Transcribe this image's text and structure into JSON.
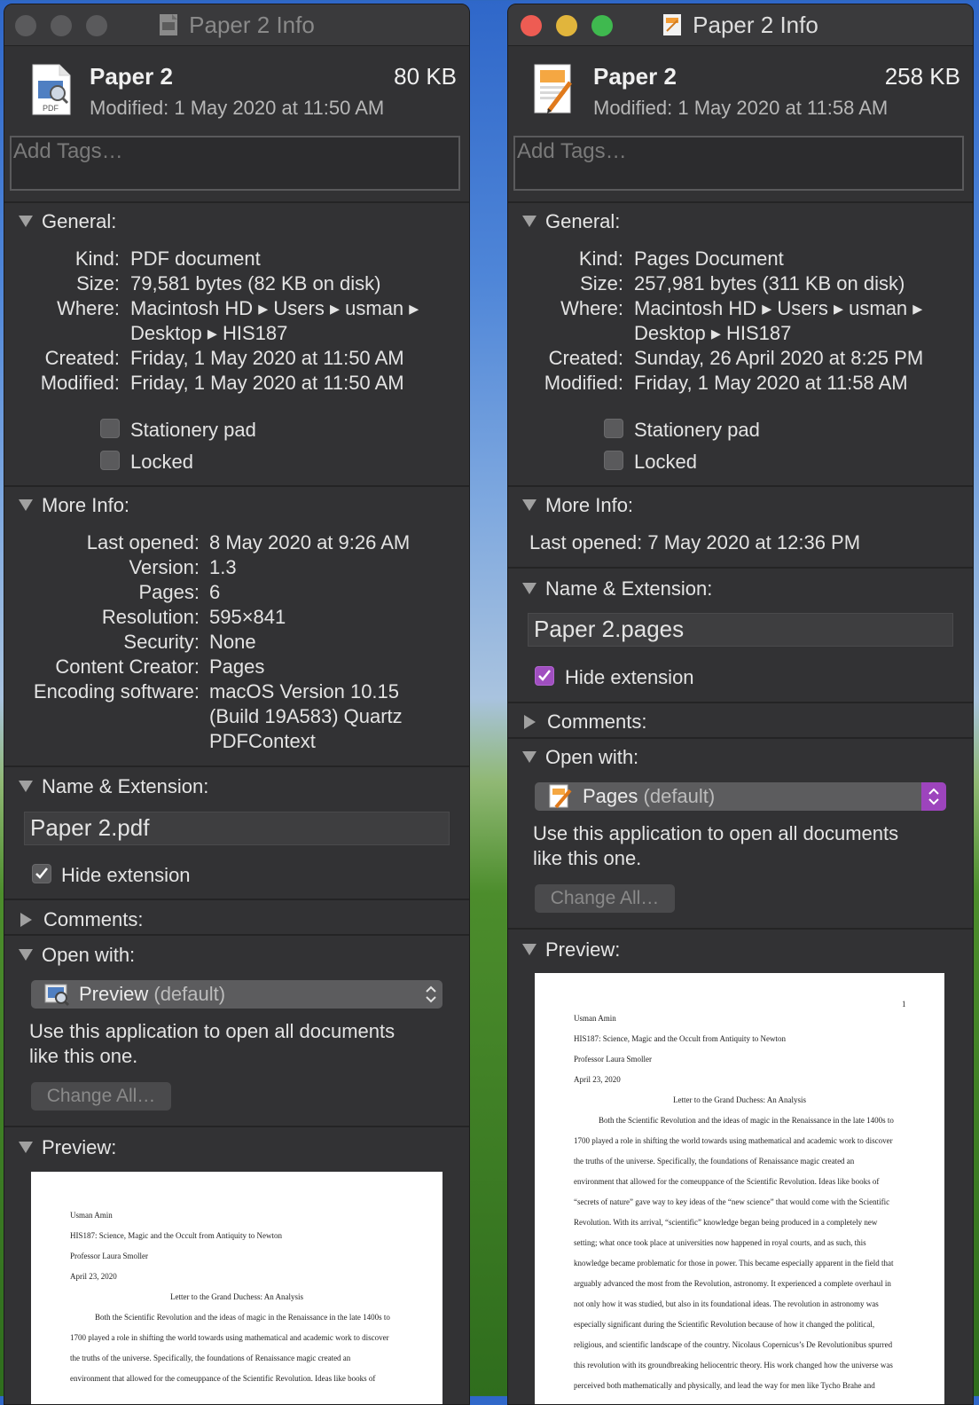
{
  "left": {
    "title": "Paper 2 Info",
    "name": "Paper 2",
    "size": "80 KB",
    "modified": "Modified: 1 May 2020 at 11:50 AM",
    "tags_placeholder": "Add Tags…",
    "file_icon_label": "PDF",
    "general": {
      "header": "General:",
      "kind_label": "Kind:",
      "kind": "PDF document",
      "size_label": "Size:",
      "size": "79,581 bytes (82 KB on disk)",
      "where_label": "Where:",
      "where_line1": "Macintosh HD ▸ Users ▸ usman ▸",
      "where_line2": "Desktop ▸ HIS187",
      "created_label": "Created:",
      "created": "Friday, 1 May 2020 at 11:50 AM",
      "modified_label": "Modified:",
      "modified": "Friday, 1 May 2020 at 11:50 AM",
      "stationery": "Stationery pad",
      "locked": "Locked"
    },
    "more_info": {
      "header": "More Info:",
      "last_opened_label": "Last opened:",
      "last_opened": "8 May 2020 at 9:26 AM",
      "version_label": "Version:",
      "version": "1.3",
      "pages_label": "Pages:",
      "pages": "6",
      "resolution_label": "Resolution:",
      "resolution": "595×841",
      "security_label": "Security:",
      "security": "None",
      "creator_label": "Content Creator:",
      "creator": "Pages",
      "encoding_label": "Encoding software:",
      "encoding_line1": "macOS Version 10.15",
      "encoding_line2": "(Build 19A583) Quartz",
      "encoding_line3": "PDFContext"
    },
    "name_ext": {
      "header": "Name & Extension:",
      "value": "Paper 2.pdf",
      "hide": "Hide extension",
      "hide_checked": true
    },
    "comments_header": "Comments:",
    "open_with": {
      "header": "Open with:",
      "app": "Preview",
      "default": "(default)",
      "desc_line1": "Use this application to open all documents",
      "desc_line2": "like this one.",
      "change_all": "Change All…"
    },
    "preview": {
      "header": "Preview:",
      "lines": [
        "Usman Amin",
        "HIS187: Science, Magic and the Occult from Antiquity to Newton",
        "Professor Laura Smoller",
        "April 23, 2020",
        "Letter to the Grand Duchess: An Analysis",
        "Both the Scientific Revolution and the ideas of magic in the Renaissance in the late 1400s to",
        "1700 played a role in shifting the world towards using mathematical and academic work to discover",
        "the truths of the universe. Specifically, the foundations of Renaissance magic created an",
        "environment that allowed for the comeuppance of the Scientific Revolution. Ideas like books of"
      ]
    }
  },
  "right": {
    "title": "Paper 2 Info",
    "name": "Paper 2",
    "size": "258 KB",
    "modified": "Modified: 1 May 2020 at 11:58 AM",
    "tags_placeholder": "Add Tags…",
    "general": {
      "header": "General:",
      "kind_label": "Kind:",
      "kind": "Pages Document",
      "size_label": "Size:",
      "size": "257,981 bytes (311 KB on disk)",
      "where_label": "Where:",
      "where_line1": "Macintosh HD ▸ Users ▸ usman ▸",
      "where_line2": "Desktop ▸ HIS187",
      "created_label": "Created:",
      "created": "Sunday, 26 April 2020 at 8:25 PM",
      "modified_label": "Modified:",
      "modified": "Friday, 1 May 2020 at 11:58 AM",
      "stationery": "Stationery pad",
      "locked": "Locked"
    },
    "more_info": {
      "header": "More Info:",
      "last_opened_label": "Last opened:",
      "last_opened": "7 May 2020 at 12:36 PM"
    },
    "name_ext": {
      "header": "Name & Extension:",
      "value": "Paper 2.pages",
      "hide": "Hide extension",
      "hide_checked": true
    },
    "comments_header": "Comments:",
    "open_with": {
      "header": "Open with:",
      "app": "Pages",
      "default": "(default)",
      "desc_line1": "Use this application to open all documents",
      "desc_line2": "like this one.",
      "change_all": "Change All…"
    },
    "preview": {
      "header": "Preview:",
      "page_number": "1",
      "lines": [
        "Usman Amin",
        "HIS187: Science, Magic and the Occult from Antiquity to Newton",
        "Professor Laura Smoller",
        "April 23, 2020",
        "Letter to the Grand Duchess: An Analysis",
        "Both the Scientific Revolution and the ideas of magic in the Renaissance in the late 1400s to",
        "1700 played a role in shifting the world towards using mathematical and academic work to discover",
        "the truths of the universe. Specifically, the foundations of Renaissance magic created an",
        "environment that allowed for the comeuppance of the Scientific Revolution. Ideas like books of",
        "“secrets of nature” gave way to key ideas of the “new science” that would come with the Scientific",
        "Revolution. With its arrival, “scientific” knowledge began being produced in a completely new",
        "setting; what once took place at universities now happened in royal courts, and as such, this",
        "knowledge became problematic for those in power. This became especially apparent in the field that",
        "arguably advanced the most from the Revolution, astronomy. It experienced a complete overhaul in",
        "not only how it was studied, but also in its foundational ideas. The revolution in astronomy was",
        "especially significant during the Scientific Revolution because of how it changed the political,",
        "religious, and scientific landscape of the country. Nicolaus Copernicus’s De Revolutionibus spurred",
        "this revolution with its groundbreaking heliocentric theory. His work changed how the universe was",
        "perceived both mathematically and physically, and lead the way for men like Tycho Brahe and"
      ]
    }
  }
}
